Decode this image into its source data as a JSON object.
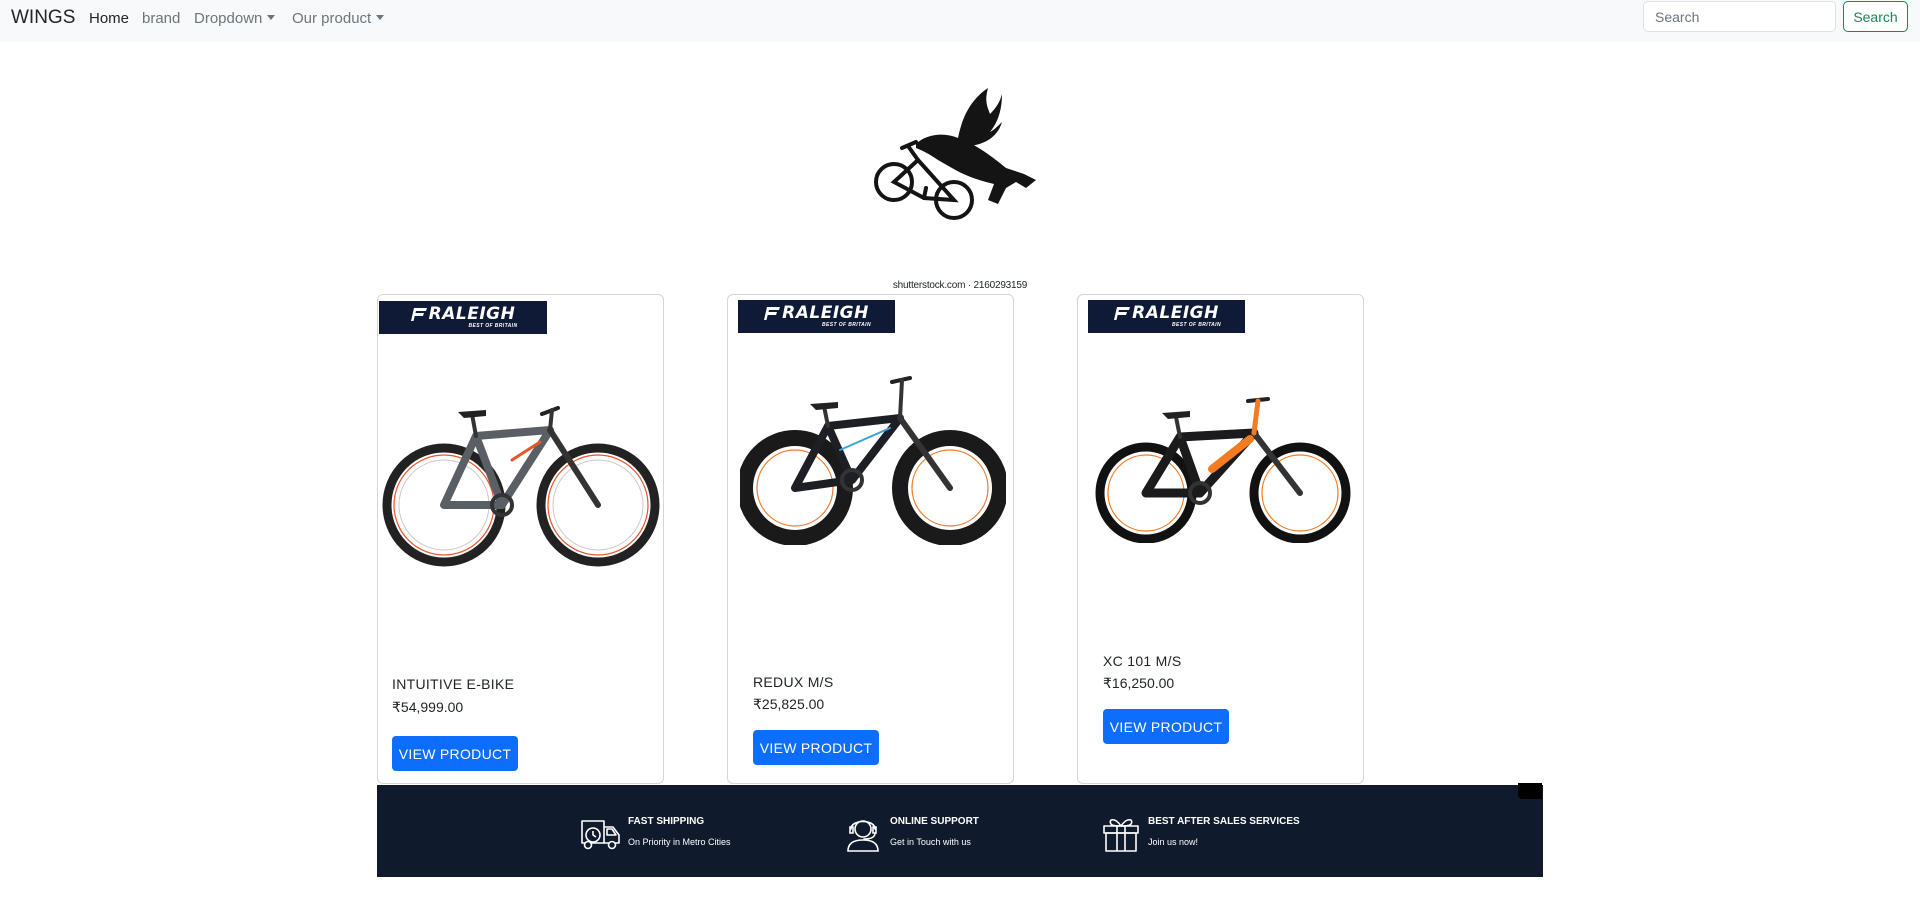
{
  "navbar": {
    "brand": "WINGS",
    "links": [
      {
        "label": "Home",
        "active": true
      },
      {
        "label": "brand"
      },
      {
        "label": "Dropdown",
        "dropdown": true
      },
      {
        "label": "Our product",
        "dropdown": true
      }
    ],
    "search": {
      "placeholder": "Search",
      "button_label": "Search"
    }
  },
  "hero": {
    "logo_icon": "winged-cyclist-logo",
    "credit": "shutterstock.com · 2160293159"
  },
  "products": [
    {
      "banner": {
        "brand": "RALEIGH",
        "tagline": "BEST OF BRITAIN"
      },
      "name": "INTUITIVE E-BIKE",
      "price": "₹54,999.00",
      "button": "VIEW PRODUCT",
      "frame_color": "#5a5f66",
      "accent_color": "#e8542c"
    },
    {
      "banner": {
        "brand": "RALEIGH",
        "tagline": "BEST OF BRITAIN"
      },
      "name": "REDUX M/S",
      "price": "₹25,825.00",
      "button": "VIEW PRODUCT",
      "frame_color": "#1d1f24",
      "accent_color": "#f07a2a"
    },
    {
      "banner": {
        "brand": "RALEIGH",
        "tagline": "BEST OF BRITAIN"
      },
      "name": "XC 101 M/S",
      "price": "₹16,250.00",
      "button": "VIEW PRODUCT",
      "frame_color": "#1b1b1d",
      "accent_color": "#f47b20"
    }
  ],
  "features": [
    {
      "icon": "delivery-truck-icon",
      "title": "FAST SHIPPING",
      "desc": "On Priority in Metro Cities"
    },
    {
      "icon": "support-headset-icon",
      "title": "ONLINE SUPPORT",
      "desc": "Get in Touch with us"
    },
    {
      "icon": "gift-box-icon",
      "title": "BEST AFTER SALES SERVICES",
      "desc": "Join us now!"
    }
  ],
  "colors": {
    "primary": "#0d6efd",
    "success": "#198754",
    "navbar_bg": "#f8f9fa",
    "footer_bg": "#0f1a2d",
    "banner_bg": "#0f1a36"
  }
}
